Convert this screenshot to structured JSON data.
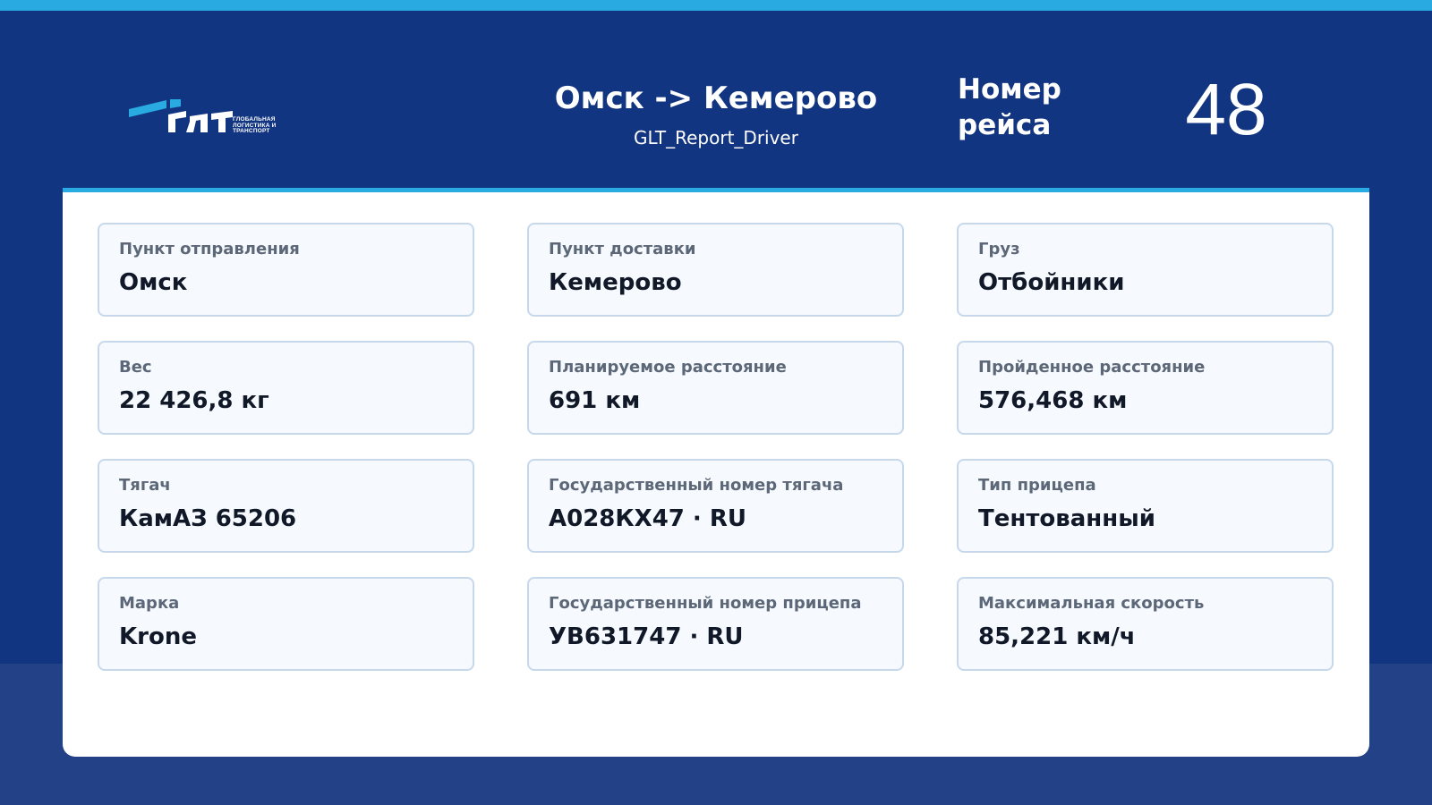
{
  "header": {
    "logo_text": "ГЛТ",
    "logo_tagline": "ГЛОБАЛЬНАЯ\nЛОГИСТИКА И\nТРАНСПОРТ",
    "route_title": "Омск -> Кемерово",
    "subtitle": "GLT_Report_Driver",
    "trip_label": "Номер\nрейса",
    "trip_number": "48"
  },
  "colors": {
    "accent": "#29ABE2",
    "header_bg": "#123581",
    "page_bg": "#234187",
    "card_bg": "#F6FAFF",
    "card_border": "#C7D8EA"
  },
  "cards": [
    {
      "label": "Пункт отправления",
      "value": "Омск"
    },
    {
      "label": "Пункт доставки",
      "value": "Кемерово"
    },
    {
      "label": "Груз",
      "value": "Отбойники"
    },
    {
      "label": "Вес",
      "value": "22 426,8 кг"
    },
    {
      "label": "Планируемое расстояние",
      "value": "691 км"
    },
    {
      "label": "Пройденное расстояние",
      "value": "576,468 км"
    },
    {
      "label": "Тягач",
      "value": "КамАЗ 65206"
    },
    {
      "label": "Государственный номер тягача",
      "value": "А028КХ47 · RU"
    },
    {
      "label": "Тип прицепа",
      "value": "Тентованный"
    },
    {
      "label": "Марка",
      "value": "Krone"
    },
    {
      "label": "Государственный номер прицепа",
      "value": "УВ631747 · RU"
    },
    {
      "label": "Максимальная скорость",
      "value": "85,221 км/ч"
    }
  ]
}
